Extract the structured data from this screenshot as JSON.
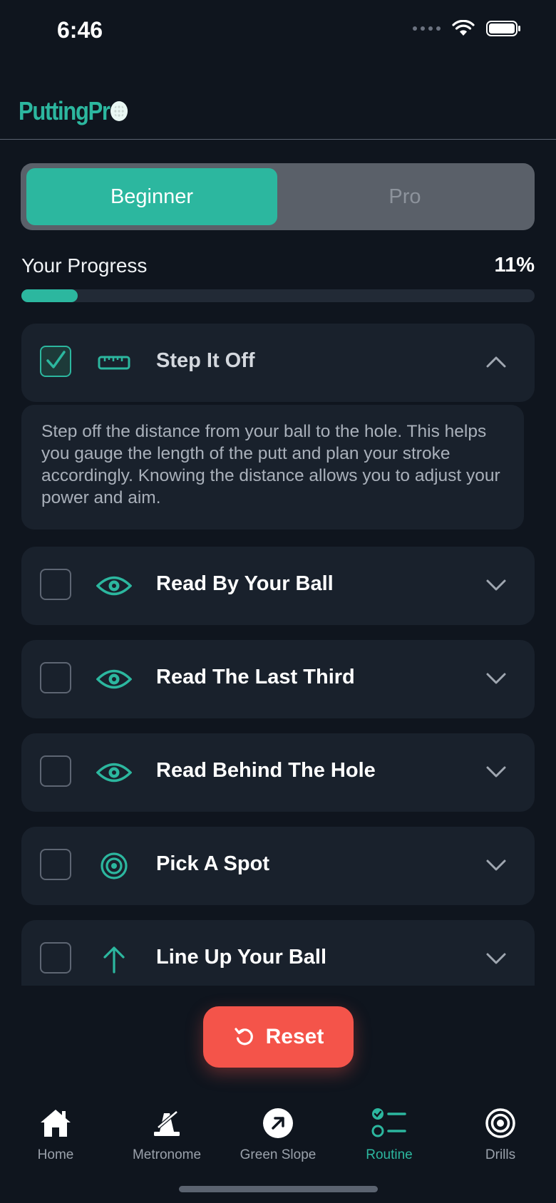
{
  "status_bar": {
    "time": "6:46"
  },
  "header": {
    "logo_text": "PuttingPr"
  },
  "level_toggle": {
    "options": [
      "Beginner",
      "Pro"
    ],
    "selected": "Beginner"
  },
  "progress": {
    "label": "Your Progress",
    "value_text": "11%",
    "fraction": 0.11
  },
  "routine": {
    "steps": [
      {
        "title": "Step It Off",
        "icon": "ruler-icon",
        "checked": true,
        "expanded": true,
        "description": "Step off the distance from your ball to the hole. This helps you gauge the length of the putt and plan your stroke accordingly. Knowing the distance allows you to adjust your power and aim."
      },
      {
        "title": "Read By Your Ball",
        "icon": "eye-icon",
        "checked": false,
        "expanded": false
      },
      {
        "title": "Read The Last Third",
        "icon": "eye-icon",
        "checked": false,
        "expanded": false
      },
      {
        "title": "Read Behind The Hole",
        "icon": "eye-icon",
        "checked": false,
        "expanded": false
      },
      {
        "title": "Pick A Spot",
        "icon": "target-icon",
        "checked": false,
        "expanded": false
      },
      {
        "title": "Line Up Your Ball",
        "icon": "arrow-up-icon",
        "checked": false,
        "expanded": false
      }
    ]
  },
  "reset_button": {
    "label": "Reset",
    "icon": "rotate-ccw-icon"
  },
  "tab_bar": {
    "tabs": [
      {
        "label": "Home",
        "icon": "house-icon"
      },
      {
        "label": "Metronome",
        "icon": "metronome-icon"
      },
      {
        "label": "Green Slope",
        "icon": "arrow-up-right-circle-icon"
      },
      {
        "label": "Routine",
        "icon": "checklist-icon"
      },
      {
        "label": "Drills",
        "icon": "target-icon"
      }
    ],
    "active": "Routine"
  },
  "colors": {
    "accent": "#2cb79f",
    "background": "#0f151e",
    "card": "#19212c",
    "reset": "#f4544a"
  }
}
